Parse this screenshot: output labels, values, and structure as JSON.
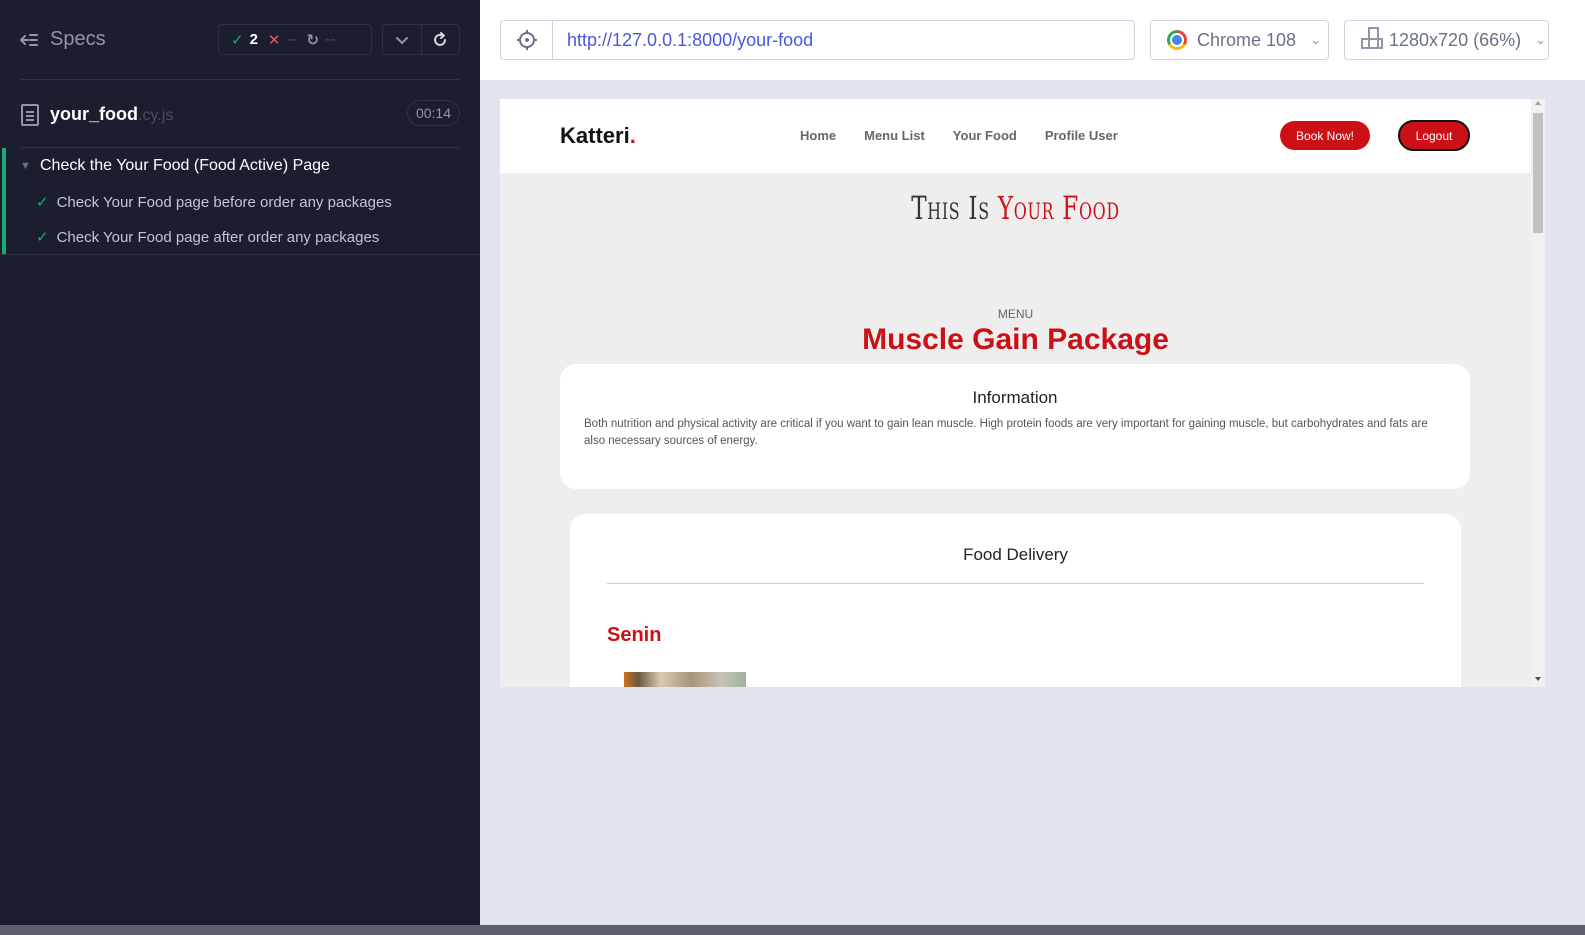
{
  "reporter": {
    "specs_label": "Specs",
    "stats": {
      "passed": "2",
      "failed": "--",
      "pending": "--"
    },
    "spec": {
      "name": "your_food",
      "ext": ".cy.js",
      "duration": "00:14"
    },
    "suite": {
      "title": "Check the Your Food (Food Active) Page",
      "tests": [
        "Check Your Food page before order any packages",
        "Check Your Food page after order any packages"
      ]
    }
  },
  "aut": {
    "url": "http://127.0.0.1:8000/your-food",
    "browser": "Chrome 108",
    "viewport": "1280x720 (66%)"
  },
  "site": {
    "logo": "Katteri",
    "logo_dot": ".",
    "nav": [
      "Home",
      "Menu List",
      "Your Food",
      "Profile User"
    ],
    "book_label": "Book Now!",
    "logout_label": "Logout",
    "hero_prefix": "This Is ",
    "hero_highlight": "Your Food",
    "menu_label": "MENU",
    "package_title": "Muscle Gain Package",
    "info_heading": "Information",
    "info_text": "Both nutrition and physical activity are critical if you want to gain lean muscle. High protein foods are very important for gaining muscle, but carbohydrates and fats are also necessary sources of energy.",
    "delivery_heading": "Food Delivery",
    "day_title": "Senin"
  },
  "colors": {
    "accent_red": "#cc1016",
    "pass_green": "#1fa971",
    "fail_red": "#e45770",
    "url_blue": "#4956e3",
    "reporter_bg": "#1b1e2e"
  },
  "icons": [
    "list-collapse-icon",
    "check-icon",
    "close-icon",
    "spinner-icon",
    "chevron-down-icon",
    "refresh-icon",
    "file-icon",
    "crosshair-icon",
    "chrome-icon",
    "ruler-icon"
  ]
}
